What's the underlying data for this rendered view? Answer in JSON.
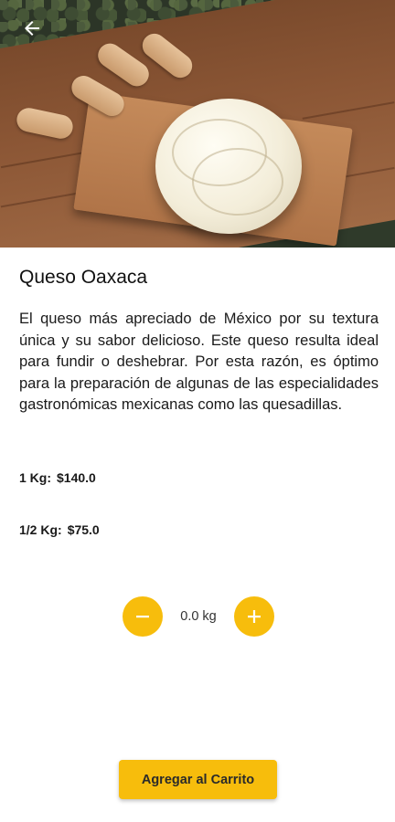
{
  "product": {
    "name": "Queso Oaxaca",
    "description": "El queso más apreciado de México por su textura única y su sabor delicioso. Este queso resulta ideal para fundir o deshebrar. Por esta razón, es óptimo para la preparación de algunas de las especialidades gastronómicas mexicanas como las quesadillas.",
    "prices": [
      {
        "label": "1 Kg:",
        "value": "$140.0"
      },
      {
        "label": "1/2 Kg:",
        "value": "$75.0"
      }
    ]
  },
  "quantity": {
    "value": "0.0 kg"
  },
  "actions": {
    "add_to_cart_label": "Agregar al Carrito"
  },
  "icons": {
    "back": "arrow-left-icon",
    "minus": "minus-icon",
    "plus": "plus-icon"
  },
  "colors": {
    "accent": "#f7bd0c",
    "text": "#111111"
  }
}
